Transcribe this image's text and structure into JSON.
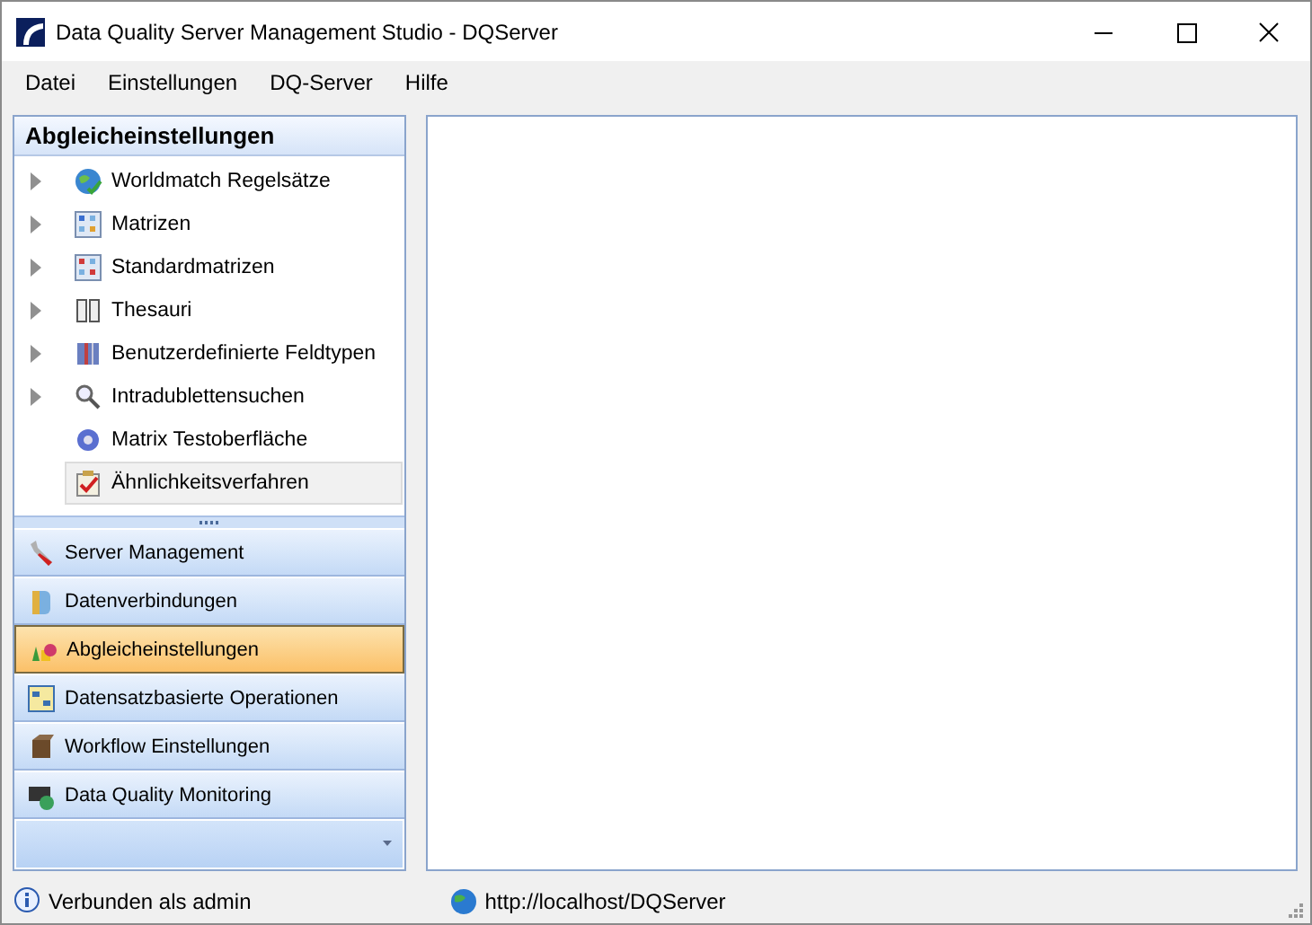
{
  "window": {
    "title": "Data Quality Server Management Studio - DQServer"
  },
  "menu": [
    "Datei",
    "Einstellungen",
    "DQ-Server",
    "Hilfe"
  ],
  "panel": {
    "title": "Abgleicheinstellungen",
    "tree": [
      {
        "label": "Worldmatch Regelsätze",
        "has_children": true,
        "selected": false
      },
      {
        "label": "Matrizen",
        "has_children": true,
        "selected": false
      },
      {
        "label": "Standardmatrizen",
        "has_children": true,
        "selected": false
      },
      {
        "label": "Thesauri",
        "has_children": true,
        "selected": false
      },
      {
        "label": "Benutzerdefinierte Feldtypen",
        "has_children": true,
        "selected": false
      },
      {
        "label": "Intradublettensuchen",
        "has_children": true,
        "selected": false
      },
      {
        "label": "Matrix Testoberfläche",
        "has_children": false,
        "selected": false
      },
      {
        "label": "Ähnlichkeitsverfahren",
        "has_children": false,
        "selected": true
      }
    ]
  },
  "navigation": [
    {
      "label": "Server Management",
      "selected": false
    },
    {
      "label": "Datenverbindungen",
      "selected": false
    },
    {
      "label": "Abgleicheinstellungen",
      "selected": true
    },
    {
      "label": "Datensatzbasierte Operationen",
      "selected": false
    },
    {
      "label": "Workflow Einstellungen",
      "selected": false
    },
    {
      "label": "Data Quality Monitoring",
      "selected": false
    }
  ],
  "status_bar": {
    "connection": "Verbunden als admin",
    "url": "http://localhost/DQServer"
  }
}
